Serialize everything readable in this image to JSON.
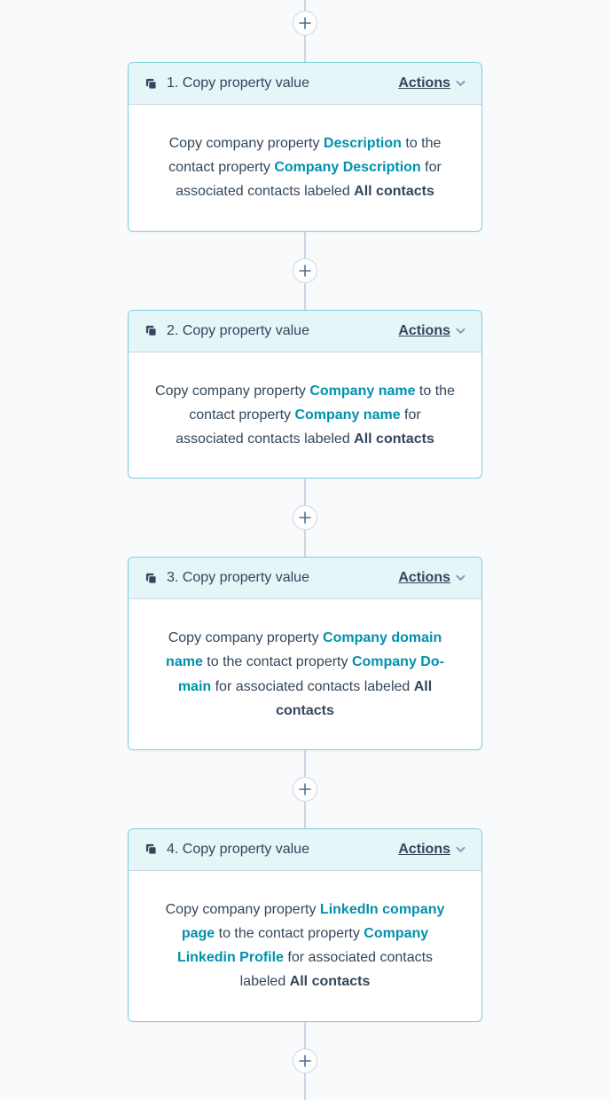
{
  "actions_label": "Actions",
  "body_prefix": "Copy company property ",
  "body_mid": " to the contact property ",
  "body_suffix_pre": " for associated contacts labeled ",
  "steps": [
    {
      "title": "1. Copy property value",
      "source": "Description",
      "target": "Company Description",
      "labeled": "All contacts"
    },
    {
      "title": "2. Copy property value",
      "source": "Company name",
      "target": "Company name",
      "labeled": "All contacts"
    },
    {
      "title": "3. Copy property value",
      "source": "Company domain name",
      "target": "Company Do­main",
      "labeled": "All contacts"
    },
    {
      "title": "4. Copy property value",
      "source": "LinkedIn company page",
      "target": "Company Linkedin Profile",
      "labeled": "All contacts"
    }
  ]
}
